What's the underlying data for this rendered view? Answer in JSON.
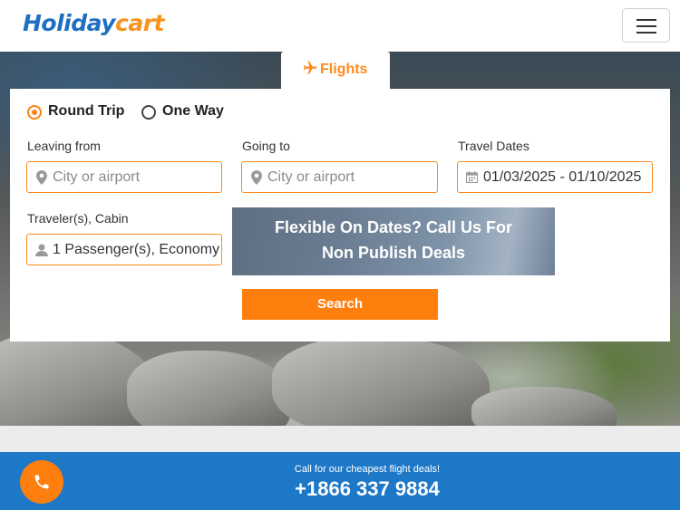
{
  "header": {
    "logo_part1": "Holiday",
    "logo_part2": "cart",
    "menu_icon": "hamburger-icon"
  },
  "tab": {
    "icon": "plane-icon",
    "label": "Flights"
  },
  "trip_type": {
    "options": [
      "Round Trip",
      "One Way"
    ],
    "selected": "Round Trip"
  },
  "form": {
    "leaving_from": {
      "label": "Leaving from",
      "placeholder": "City or airport",
      "value": "",
      "icon": "map-pin-icon"
    },
    "going_to": {
      "label": "Going to",
      "placeholder": "City or airport",
      "value": "",
      "icon": "map-pin-icon"
    },
    "travel_dates": {
      "label": "Travel Dates",
      "value": "01/03/2025 - 01/10/2025",
      "icon": "calendar-icon"
    },
    "travelers": {
      "label": "Traveler(s), Cabin",
      "value": "1 Passenger(s), Economy",
      "icon": "user-icon"
    }
  },
  "promo": {
    "line1": "Flexible On Dates? Call Us For",
    "line2": "Non Publish Deals"
  },
  "search_label": "Search",
  "call": {
    "icon": "phone-icon",
    "caption": "Call for our cheapest flight deals!",
    "number": "+1866 337 9884"
  },
  "colors": {
    "brand_blue": "#1e6fc1",
    "accent_orange": "#ff7f0e",
    "call_bar_blue": "#1e78c8"
  }
}
